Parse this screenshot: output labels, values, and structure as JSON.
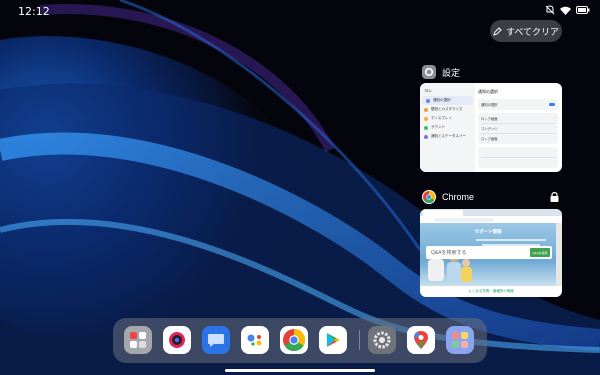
{
  "status_bar": {
    "time": "12:12"
  },
  "clear_all": {
    "label": "すべてクリア"
  },
  "recents": [
    {
      "app_name": "設定",
      "settings_preview": {
        "sidebar_header": "ヨレ",
        "sidebar_items": [
          {
            "label": "通知の選択",
            "color": "#5a8bf0",
            "active": true
          },
          {
            "label": "壁紙とカスタマイズ",
            "color": "#f0a030",
            "active": false
          },
          {
            "label": "ディスプレイ",
            "color": "#f3b23a",
            "active": false
          },
          {
            "label": "サウンド",
            "color": "#3cbf7e",
            "active": false
          },
          {
            "label": "通知とステータスバー",
            "color": "#7a72e8",
            "active": false
          }
        ],
        "main_title": "通知の選択",
        "rows": [
          "通知の選択",
          "ロック画面",
          "コンテンツ",
          "ロック画面"
        ]
      }
    },
    {
      "app_name": "Chrome",
      "locked": true,
      "chrome_preview": {
        "hero_title": "サポート情報",
        "search_placeholder": "Q&Aを検索する",
        "search_button": "Q&Aを検索",
        "links": "よくある質問・機種別の情報"
      }
    }
  ],
  "dock": {
    "apps": [
      {
        "name": "folder",
        "icon": "folder-grid-icon"
      },
      {
        "name": "camera",
        "icon": "camera-icon"
      },
      {
        "name": "messages",
        "icon": "messages-icon"
      },
      {
        "name": "assistant",
        "icon": "assistant-icon"
      },
      {
        "name": "chrome",
        "icon": "chrome-icon"
      },
      {
        "name": "play-store",
        "icon": "play-store-icon"
      },
      {
        "name": "settings",
        "icon": "settings-gear-icon"
      },
      {
        "name": "maps",
        "icon": "maps-icon"
      },
      {
        "name": "apps",
        "icon": "app-drawer-icon"
      }
    ]
  }
}
